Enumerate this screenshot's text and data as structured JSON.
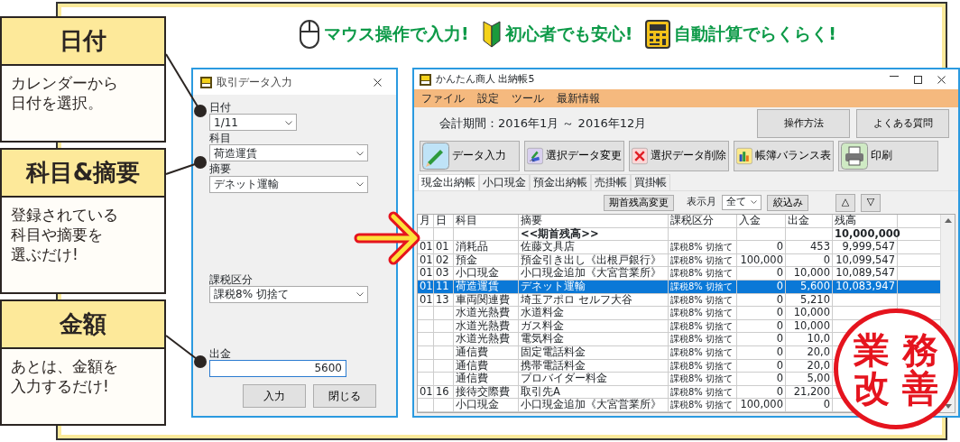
{
  "callouts": [
    {
      "title": "日付",
      "lines": [
        "カレンダーから",
        "日付を選択。"
      ]
    },
    {
      "title": "科目&摘要",
      "lines": [
        "登録されている",
        "科目や摘要を",
        "選ぶだけ!"
      ]
    },
    {
      "title": "金額",
      "lines": [
        "あとは、金額を",
        "入力するだけ!"
      ]
    }
  ],
  "headline": [
    {
      "kind": "mouse",
      "text": "マウス操作で入力!"
    },
    {
      "kind": "beginner",
      "text": "初心者でも安心!"
    },
    {
      "kind": "calculator",
      "text": "自動計算でらくらく!"
    }
  ],
  "dialog": {
    "title": "取引データ入力",
    "fields": [
      {
        "kind": "date",
        "label": "日付",
        "value": "1/11"
      },
      {
        "kind": "select",
        "label": "科目",
        "value": "荷造運賃"
      },
      {
        "kind": "select",
        "label": "摘要",
        "value": "デネット運輸"
      },
      {
        "kind": "select",
        "label": "課税区分",
        "value": "課税8% 切捨て"
      },
      {
        "kind": "input",
        "label": "出金",
        "value": "5600"
      }
    ],
    "buttons": [
      "入力",
      "閉じる"
    ]
  },
  "main_window": {
    "title": "かんたん商人 出納帳5",
    "menu": [
      "ファイル",
      "設定",
      "ツール",
      "最新情報"
    ],
    "period": "会計期間：2016年1月 ～ 2016年12月",
    "help_buttons": [
      "操作方法",
      "よくある質問"
    ],
    "toolbar": [
      {
        "kind": "pencil",
        "label": "データ入力"
      },
      {
        "kind": "edit",
        "label": "選択データ変更"
      },
      {
        "kind": "delete",
        "label": "選択データ削除"
      },
      {
        "kind": "chart",
        "label": "帳簿バランス表"
      },
      {
        "kind": "printer",
        "label": "印刷"
      }
    ],
    "tabs": [
      {
        "label": "現金出納帳",
        "selected": true
      },
      {
        "label": "小口現金",
        "selected": false
      },
      {
        "label": "預金出納帳",
        "selected": false
      },
      {
        "label": "売掛帳",
        "selected": false
      },
      {
        "label": "買掛帳",
        "selected": false
      }
    ],
    "filter": {
      "opening_button": "期首残高変更",
      "month_label": "表示月",
      "month_value": "全て",
      "filter_button": "絞込み",
      "up_button": "△",
      "down_button": "▽"
    },
    "table": {
      "columns": [
        "月",
        "日",
        "科目",
        "摘要",
        "課税区分",
        "入金",
        "出金",
        "残高"
      ],
      "rows": [
        {
          "kind": "opening",
          "selected": false,
          "memo": "<<期首残高>>",
          "balance": "10,000,000"
        },
        {
          "kind": "entry",
          "selected": false,
          "month": "01",
          "day": "01",
          "account": "消耗品",
          "memo": "佐藤文具店",
          "tax": "課税8% 切捨て",
          "deposit": "0",
          "withdrawal": "453",
          "balance": "9,999,547"
        },
        {
          "kind": "entry",
          "selected": false,
          "month": "01",
          "day": "02",
          "account": "預金",
          "memo": "預金引き出し《出根戸銀行》",
          "tax": "課税8% 切捨て",
          "deposit": "100,000",
          "withdrawal": "0",
          "balance": "10,099,547"
        },
        {
          "kind": "entry",
          "selected": false,
          "month": "01",
          "day": "03",
          "account": "小口現金",
          "memo": "小口現金追加《大宮営業所》",
          "tax": "課税8% 切捨て",
          "deposit": "0",
          "withdrawal": "10,000",
          "balance": "10,089,547"
        },
        {
          "kind": "entry",
          "selected": true,
          "month": "01",
          "day": "11",
          "account": "荷造運賃",
          "memo": "デネット運輸",
          "tax": "課税8% 切捨て",
          "deposit": "0",
          "withdrawal": "5,600",
          "balance": "10,083,947"
        },
        {
          "kind": "entry",
          "selected": false,
          "month": "01",
          "day": "13",
          "account": "車両関連費",
          "memo": "埼玉アポロ セルフ大谷",
          "tax": "課税8% 切捨て",
          "deposit": "0",
          "withdrawal": "5,210"
        },
        {
          "kind": "entry",
          "selected": false,
          "account": "水道光熱費",
          "memo": "水道料金",
          "tax": "課税8% 切捨て",
          "deposit": "0",
          "withdrawal": "10,000"
        },
        {
          "kind": "entry",
          "selected": false,
          "account": "水道光熱費",
          "memo": "ガス料金",
          "tax": "課税8% 切捨て",
          "deposit": "0",
          "withdrawal": "10,000"
        },
        {
          "kind": "entry",
          "selected": false,
          "account": "水道光熱費",
          "memo": "電気料金",
          "tax": "課税8% 切捨て",
          "deposit": "0",
          "withdrawal": "10,0"
        },
        {
          "kind": "entry",
          "selected": false,
          "account": "通信費",
          "memo": "固定電話料金",
          "tax": "課税8% 切捨て",
          "deposit": "0",
          "withdrawal": "20,0"
        },
        {
          "kind": "entry",
          "selected": false,
          "account": "通信費",
          "memo": "携帯電話料金",
          "tax": "課税8% 切捨て",
          "deposit": "0",
          "withdrawal": "20,0"
        },
        {
          "kind": "entry",
          "selected": false,
          "account": "通信費",
          "memo": "プロバイダー料金",
          "tax": "課税8% 切捨て",
          "deposit": "0",
          "withdrawal": "5,00"
        },
        {
          "kind": "entry",
          "selected": false,
          "month": "01",
          "day": "16",
          "account": "接待交際費",
          "memo": "取引先A",
          "tax": "課税8% 切捨て",
          "deposit": "0",
          "withdrawal": "21,200"
        },
        {
          "kind": "entry",
          "selected": false,
          "account": "小口現金",
          "memo": "小口現金追加《大宮営業所》",
          "tax": "課税8% 切捨て",
          "deposit": "100,000",
          "withdrawal": "0"
        }
      ]
    }
  },
  "stamp": [
    "業",
    "務",
    "改",
    "善"
  ]
}
